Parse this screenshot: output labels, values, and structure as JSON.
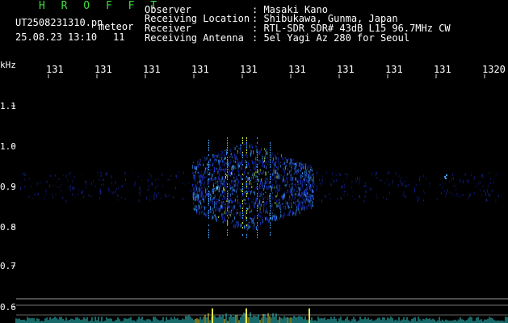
{
  "header": {
    "program": "H R O F F T",
    "filename": "UT2508231310.pn",
    "kind": "meteor",
    "datetime": "25.08.23 13:10",
    "number": "11"
  },
  "station": [
    {
      "label": "Observer",
      "value": ": Masaki Kano"
    },
    {
      "label": "Receiving Location",
      "value": ": Shibukawa, Gunma, Japan"
    },
    {
      "label": "Receiver",
      "value": ": RTL-SDR SDR# 43dB L15 96.7MHz CW"
    },
    {
      "label": "Receiving Antenna",
      "value": ": 5el Yagi Az 280 for Seoul"
    }
  ],
  "axes": {
    "y_unit": "kHz",
    "y_ticks": [
      "1.1",
      "1.0",
      "0.9",
      "0.8",
      "0.7",
      "0.6"
    ],
    "x_ticks": [
      "131",
      "131",
      "131",
      "131",
      "131",
      "131",
      "131",
      "131",
      "131",
      "1320"
    ]
  },
  "colors": {
    "text": "#ffffff",
    "title": "#3ddc3d",
    "echo_weak": "#1a2fd0",
    "echo_mid": "#3aa0ff",
    "echo_strong": "#d8ff40",
    "grid": "#9a9a9a"
  }
}
